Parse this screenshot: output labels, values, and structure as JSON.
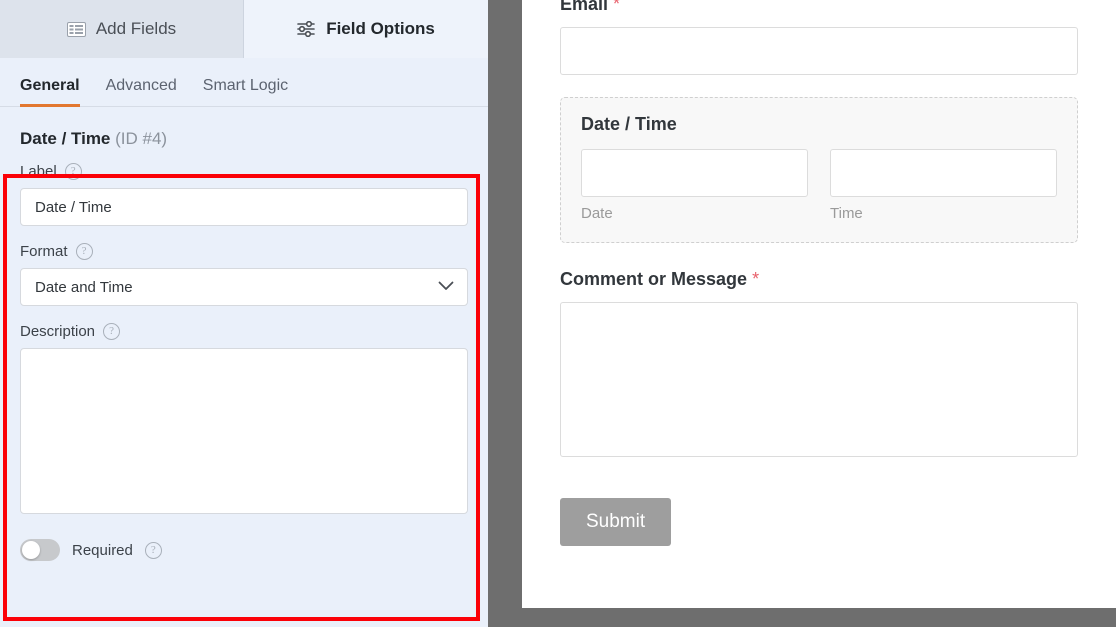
{
  "sidebar": {
    "tabs": [
      {
        "label": "Add Fields",
        "icon": "list-view-icon",
        "active": false
      },
      {
        "label": "Field Options",
        "icon": "sliders-icon",
        "active": true
      }
    ],
    "subtabs": [
      {
        "label": "General",
        "active": true
      },
      {
        "label": "Advanced",
        "active": false
      },
      {
        "label": "Smart Logic",
        "active": false
      }
    ],
    "field_heading": {
      "name": "Date / Time",
      "id": "(ID #4)"
    },
    "options": {
      "label_field": {
        "label": "Label",
        "help": "?",
        "value": "Date / Time"
      },
      "format_field": {
        "label": "Format",
        "help": "?",
        "value": "Date and Time",
        "options": [
          "Date and Time"
        ]
      },
      "description_field": {
        "label": "Description",
        "help": "?",
        "value": ""
      },
      "required_toggle": {
        "label": "Required",
        "help": "?",
        "state": "off"
      }
    }
  },
  "preview": {
    "email": {
      "label": "Email",
      "required_mark": "*",
      "value": ""
    },
    "datetime": {
      "label": "Date / Time",
      "date": {
        "sublabel": "Date",
        "value": ""
      },
      "time": {
        "sublabel": "Time",
        "value": ""
      }
    },
    "comment": {
      "label": "Comment or Message",
      "required_mark": "*",
      "value": ""
    },
    "submit": {
      "label": "Submit"
    }
  },
  "colors": {
    "accent_orange": "#e27730",
    "annotation_red": "#fb0007",
    "required_red": "#e8606b",
    "sidebar_bg": "#eaf0fa",
    "submit_gray": "#9e9e9e"
  }
}
